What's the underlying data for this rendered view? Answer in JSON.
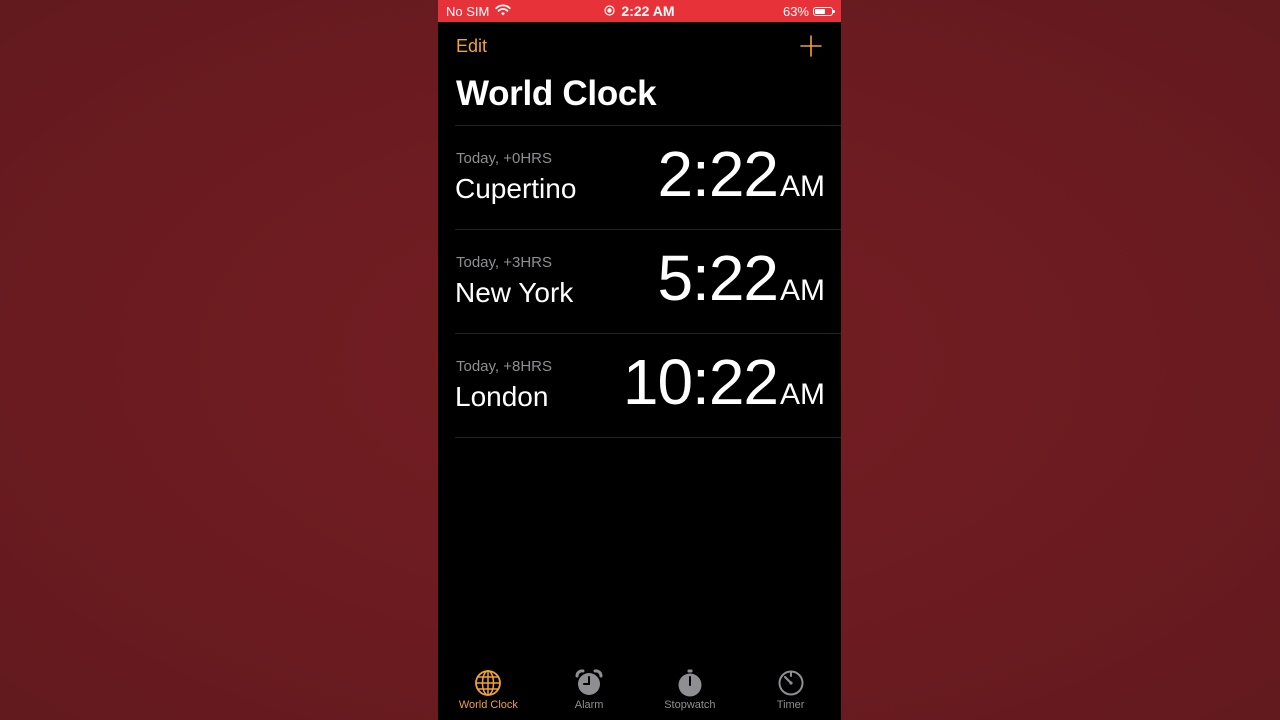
{
  "status_bar": {
    "carrier": "No SIM",
    "time": "2:22 AM",
    "battery_percent": "63%",
    "battery_level": 0.63
  },
  "nav": {
    "edit_label": "Edit",
    "add_icon": "plus-icon"
  },
  "page_title": "World Clock",
  "clocks": [
    {
      "offset": "Today, +0HRS",
      "city": "Cupertino",
      "time": "2:22",
      "ampm": "AM"
    },
    {
      "offset": "Today, +3HRS",
      "city": "New York",
      "time": "5:22",
      "ampm": "AM"
    },
    {
      "offset": "Today, +8HRS",
      "city": "London",
      "time": "10:22",
      "ampm": "AM"
    }
  ],
  "tabs": [
    {
      "label": "World Clock",
      "icon": "globe-icon",
      "active": true
    },
    {
      "label": "Alarm",
      "icon": "alarm-icon",
      "active": false
    },
    {
      "label": "Stopwatch",
      "icon": "stopwatch-icon",
      "active": false
    },
    {
      "label": "Timer",
      "icon": "timer-icon",
      "active": false
    }
  ],
  "colors": {
    "accent": "#f0a23b",
    "status_bar": "#e8323a",
    "background": "#000000",
    "backdrop": "#6e1c21",
    "inactive_tab": "#8e8e93"
  }
}
